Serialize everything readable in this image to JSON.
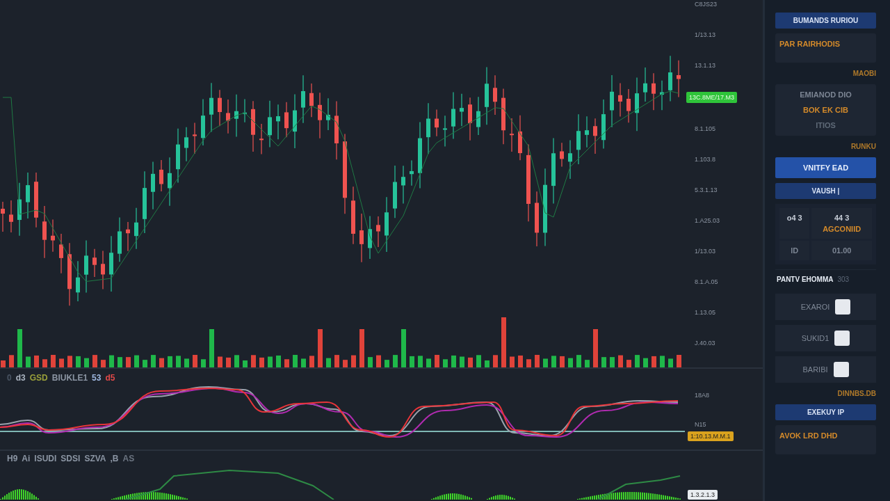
{
  "price_axis": {
    "ticks": [
      {
        "kind": "label",
        "text": "C8JS23"
      },
      {
        "kind": "label",
        "text": "1/13.13"
      },
      {
        "kind": "label",
        "text": "13.1.13"
      },
      {
        "kind": "badge",
        "text": "13C.8ME/17.M3",
        "color": "#2fc43a"
      },
      {
        "kind": "label",
        "text": "8.1.105"
      },
      {
        "kind": "label",
        "text": "1.103.8"
      },
      {
        "kind": "label",
        "text": "5.3.1.13"
      },
      {
        "kind": "label",
        "text": "1.A25.03"
      },
      {
        "kind": "label",
        "text": "1/13.03"
      },
      {
        "kind": "label",
        "text": "8.1.A.05"
      },
      {
        "kind": "label",
        "text": "1.13.05"
      },
      {
        "kind": "label",
        "text": "J.40.03"
      }
    ]
  },
  "indicator_1": {
    "legend": [
      {
        "text": "0",
        "color": "#4a5563"
      },
      {
        "text": "d3",
        "color": "#aab4c0"
      },
      {
        "text": "GSD",
        "color": "#9aa03a"
      },
      {
        "text": "BIUKLE1",
        "color": "#8b95a3"
      },
      {
        "text": "53",
        "color": "#9fb8e0"
      },
      {
        "text": "d5",
        "color": "#e04848"
      }
    ],
    "axis": [
      {
        "kind": "label",
        "text": "18A8"
      },
      {
        "kind": "label",
        "text": "N15"
      },
      {
        "kind": "badge",
        "text": "1:10.13.M.M.1",
        "color": "#d9a21e"
      }
    ]
  },
  "indicator_2": {
    "legend": [
      {
        "text": "H9",
        "color": "#8b95a3"
      },
      {
        "text": "Ai",
        "color": "#8b95a3"
      },
      {
        "text": "ISUDI",
        "color": "#8b95a3"
      },
      {
        "text": "SDSI",
        "color": "#8b95a3"
      },
      {
        "text": "SZVA",
        "color": "#8b95a3"
      },
      {
        "text": ",B",
        "color": "#8b95a3"
      },
      {
        "text": "AS",
        "color": "#6b7480"
      }
    ],
    "axis": [
      {
        "kind": "badge",
        "text": "1.3.2.1.3",
        "color": "#e8ecf0"
      }
    ]
  },
  "side_panel": {
    "sections": [
      {
        "kind": "header",
        "text": "BUMANDS RURIOU"
      },
      {
        "kind": "card",
        "lines": [
          {
            "text": "PAR RAIRHODIS",
            "color": "#d48a2a"
          }
        ]
      },
      {
        "kind": "note",
        "text": "MAOBI"
      },
      {
        "kind": "card",
        "lines": [
          {
            "text": "EMIANOD DIO",
            "color": "#7c8593"
          },
          {
            "text": "BOK EK CIB",
            "color": "#d48a2a"
          },
          {
            "text": "ITIOS",
            "color": "#5f6a78"
          }
        ]
      },
      {
        "kind": "note",
        "text": "RUNKU"
      },
      {
        "kind": "button",
        "text": "VNITFY EAD"
      },
      {
        "kind": "header",
        "text": "VAUSH |"
      },
      {
        "kind": "grid",
        "cells": [
          {
            "lines": [
              {
                "text": "o4 3",
                "color": "#c6ccd6"
              }
            ]
          },
          {
            "lines": [
              {
                "text": "44 3",
                "color": "#c6ccd6"
              },
              {
                "text": "AGCONIID",
                "color": "#d48a2a"
              }
            ]
          },
          {
            "lines": [
              {
                "text": "ID",
                "color": "#7c8593"
              }
            ]
          },
          {
            "lines": [
              {
                "text": "01.00",
                "color": "#7c8593"
              }
            ]
          }
        ]
      },
      {
        "kind": "title",
        "text": "PANTV EHOMMA",
        "extra": "303"
      },
      {
        "kind": "check",
        "text": "EXAROI",
        "checked": false
      },
      {
        "kind": "check",
        "text": "SUKID1",
        "checked": false
      },
      {
        "kind": "check",
        "text": "BARIBI",
        "checked": false
      },
      {
        "kind": "note",
        "text": "DINNBS.DB"
      },
      {
        "kind": "header",
        "text": "EXEKUY IP"
      },
      {
        "kind": "card",
        "lines": [
          {
            "text": "AVOK LRD DHD",
            "color": "#d48a2a"
          }
        ]
      }
    ]
  }
}
